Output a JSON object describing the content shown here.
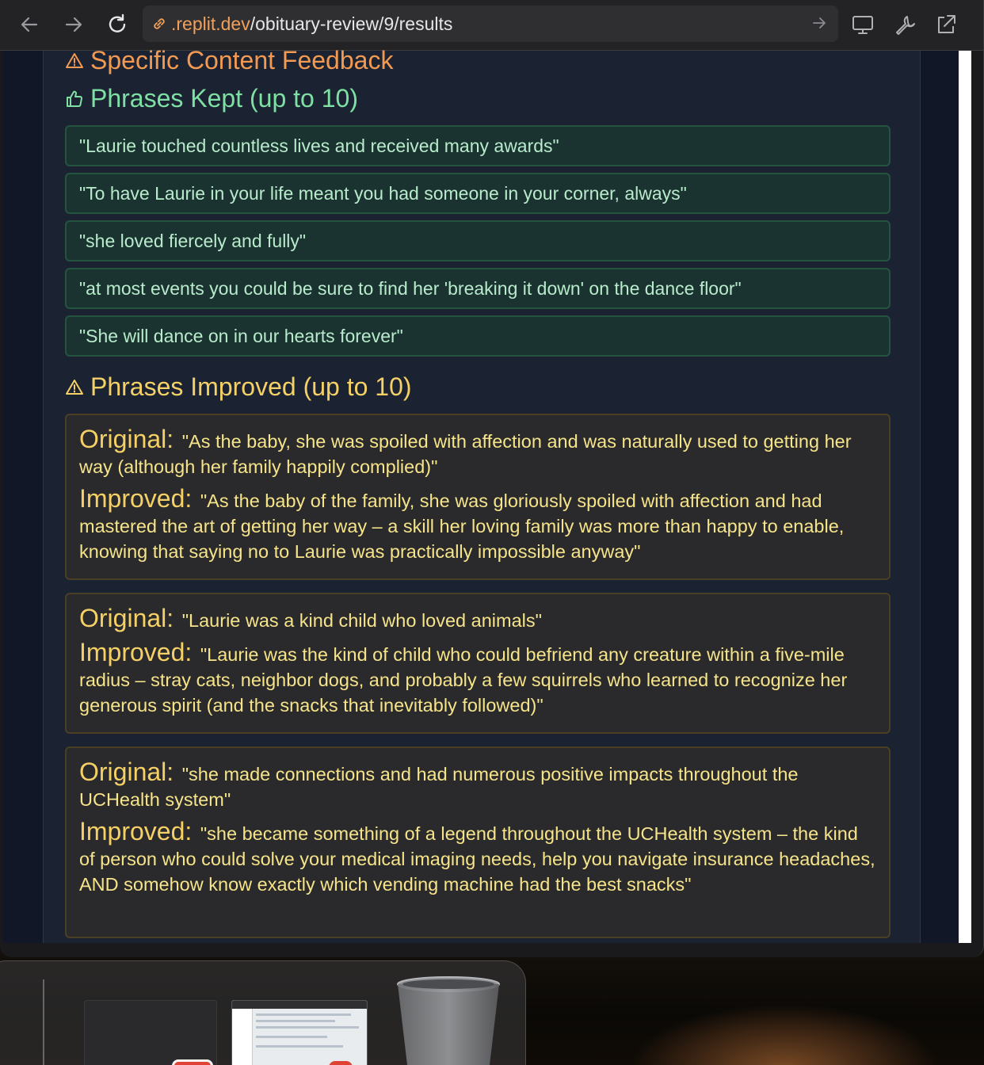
{
  "browser": {
    "url_host": ".replit.dev",
    "url_path": "/obituary-review/9/results"
  },
  "sections": {
    "feedback_title": "Specific Content Feedback",
    "kept_title": "Phrases Kept (up to 10)",
    "improved_title": "Phrases Improved (up to 10)"
  },
  "kept": [
    "\"Laurie touched countless lives and received many awards\"",
    "\"To have Laurie in your life meant you had someone in your corner, always\"",
    "\"she loved fiercely and fully\"",
    "\"at most events you could be sure to find her 'breaking it down' on the dance floor\"",
    "\"She will dance on in our hearts forever\""
  ],
  "labels": {
    "original": "Original:",
    "improved": "Improved:"
  },
  "improved": [
    {
      "original": "\"As the baby, she was spoiled with affection and was naturally used to getting her way (although her family happily complied)\"",
      "improved": "\"As the baby of the family, she was gloriously spoiled with affection and had mastered the art of getting her way – a skill her loving family was more than happy to enable, knowing that saying no to Laurie was practically impossible anyway\""
    },
    {
      "original": "\"Laurie was a kind child who loved animals\"",
      "improved": "\"Laurie was the kind of child who could befriend any creature within a five-mile radius – stray cats, neighbor dogs, and probably a few squirrels who learned to recognize her generous spirit (and the snacks that inevitably followed)\""
    },
    {
      "original": "\"she made connections and had numerous positive impacts throughout the UCHealth system\"",
      "improved": "\"she became something of a legend throughout the UCHealth system – the kind of person who could solve your medical imaging needs, help you navigate insurance headaches, AND somehow know exactly which vending machine had the best snacks\""
    }
  ],
  "icons": {
    "back": "arrow-left-icon",
    "forward": "arrow-right-icon",
    "reload": "reload-icon",
    "link": "link-icon",
    "go": "arrow-right-icon",
    "devices": "monitor-icon",
    "tools": "wrench-icon",
    "open_external": "external-link-icon",
    "warning": "warning-triangle-icon",
    "thumbs_up": "thumbs-up-icon",
    "trash": "trash-icon"
  },
  "colors": {
    "feedback_heading": "#f29a52",
    "kept_heading": "#7fe0a4",
    "improved_heading": "#f4d066",
    "url_host": "#f0a05b"
  }
}
